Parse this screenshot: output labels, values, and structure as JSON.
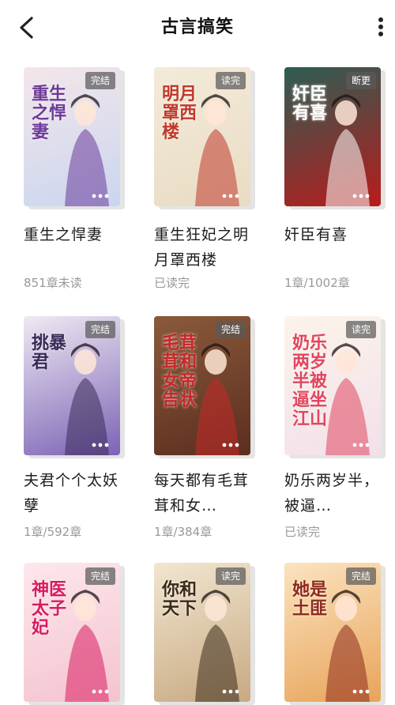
{
  "header": {
    "title": "古言搞笑"
  },
  "books": [
    {
      "title": "重生之悍妻",
      "status": "851章未读",
      "badge": "完结",
      "cover_text": "重生之悍妻",
      "cover_colors": [
        "#f4e6ea",
        "#c9d6ef"
      ],
      "accent": "#6c3a9a"
    },
    {
      "title": "重生狂妃之明月罩西楼",
      "status": "已读完",
      "badge": "读完",
      "cover_text": "明月罩西楼",
      "cover_colors": [
        "#f3ead9",
        "#e9dcc4"
      ],
      "accent": "#c0392b"
    },
    {
      "title": "奸臣有喜",
      "status": "1章/1002章",
      "badge": "断更",
      "cover_text": "奸臣有喜",
      "cover_colors": [
        "#2d5d53",
        "#b71c1c"
      ],
      "accent": "#ffffff"
    },
    {
      "title": "夫君个个太妖孽",
      "status": "1章/592章",
      "badge": "完结",
      "cover_text": "挑暴君",
      "cover_colors": [
        "#efe9f3",
        "#7b63b5"
      ],
      "accent": "#3a2a57"
    },
    {
      "title": "每天都有毛茸茸和女…",
      "status": "1章/384章",
      "badge": "完结",
      "cover_text": "毛茸茸和女帝告状",
      "cover_colors": [
        "#8a5a3b",
        "#5b2e1f"
      ],
      "accent": "#c62828"
    },
    {
      "title": "奶乐两岁半，被逼…",
      "status": "已读完",
      "badge": "读完",
      "cover_text": "奶乐两岁半被逼坐江山",
      "cover_colors": [
        "#fbf4ea",
        "#f3e0ea"
      ],
      "accent": "#e0465e"
    },
    {
      "title": "",
      "status": "",
      "badge": "完结",
      "cover_text": "神医太子妃",
      "cover_colors": [
        "#fde7ec",
        "#f4c3cf"
      ],
      "accent": "#d81b60"
    },
    {
      "title": "",
      "status": "",
      "badge": "读完",
      "cover_text": "你和天下",
      "cover_colors": [
        "#f1e6d0",
        "#c8a982"
      ],
      "accent": "#3b2a1a"
    },
    {
      "title": "",
      "status": "",
      "badge": "完结",
      "cover_text": "她是土匪",
      "cover_colors": [
        "#fbe3bf",
        "#e8a45a"
      ],
      "accent": "#8e2a1c"
    }
  ]
}
